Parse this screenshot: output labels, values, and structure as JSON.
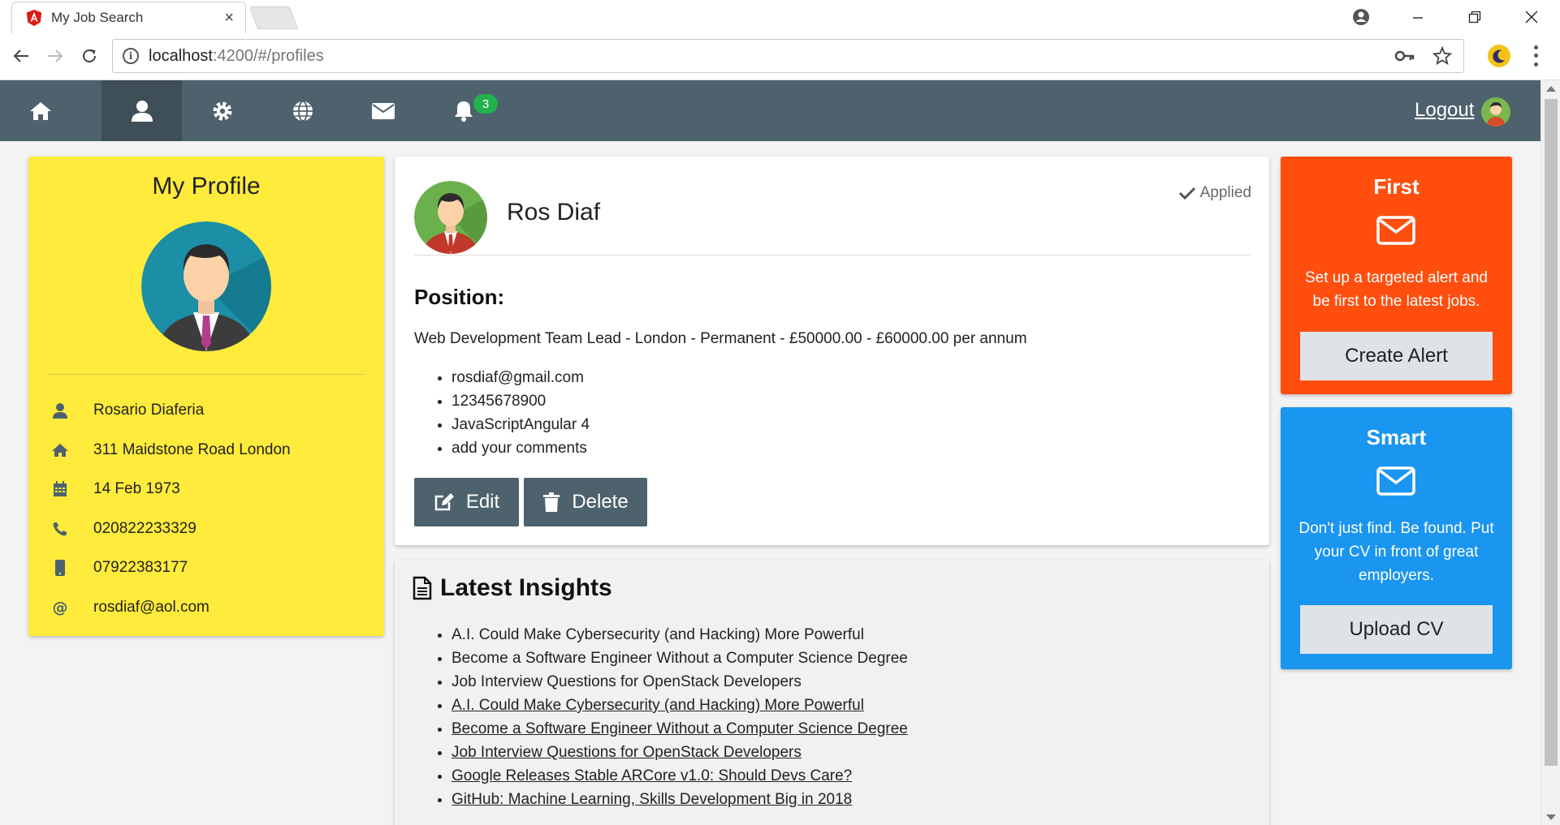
{
  "browser": {
    "tab_title": "My Job Search",
    "tab_close": "×",
    "url_host": "localhost",
    "url_rest": ":4200/#/profiles"
  },
  "nav": {
    "notification_count": "3",
    "logout_label": "Logout",
    "items": [
      "home",
      "profile",
      "settings",
      "globe",
      "mail",
      "notifications"
    ]
  },
  "profile": {
    "title": "My Profile",
    "name": "Rosario Diaferia",
    "address": "311 Maidstone Road London",
    "dob": "14 Feb 1973",
    "phone": "020822233329",
    "mobile": "07922383177",
    "email": "rosdiaf@aol.com"
  },
  "job": {
    "name": "Ros Diaf",
    "status": "Applied",
    "position_label": "Position:",
    "position_text": "Web Development Team Lead - London - Permanent - £50000.00 - £60000.00 per annum",
    "details": [
      "rosdiaf@gmail.com",
      "12345678900",
      "JavaScriptAngular 4",
      "add your comments"
    ],
    "edit_label": "Edit",
    "delete_label": "Delete"
  },
  "insights": {
    "title": "Latest Insights",
    "items": [
      "A.I. Could Make Cybersecurity (and Hacking) More Powerful",
      "Become a Software Engineer Without a Computer Science Degree",
      "Job Interview Questions for OpenStack Developers"
    ],
    "links": [
      "A.I. Could Make Cybersecurity (and Hacking) More Powerful",
      "Become a Software Engineer Without a Computer Science Degree",
      "Job Interview Questions for OpenStack Developers",
      "Google Releases Stable ARCore v1.0: Should Devs Care?",
      "GitHub: Machine Learning, Skills Development Big in 2018"
    ]
  },
  "promos": {
    "first": {
      "title": "First",
      "text": "Set up a targeted alert and be first to the latest jobs.",
      "button": "Create Alert",
      "color": "#ff4e0e"
    },
    "smart": {
      "title": "Smart",
      "text": "Don't just find. Be found. Put your CV in front of great employers.",
      "button": "Upload CV",
      "color": "#1a95f0"
    }
  },
  "colors": {
    "navbar": "#4d626d",
    "profile_card": "#ffeb3b",
    "badge": "#22b14c"
  }
}
